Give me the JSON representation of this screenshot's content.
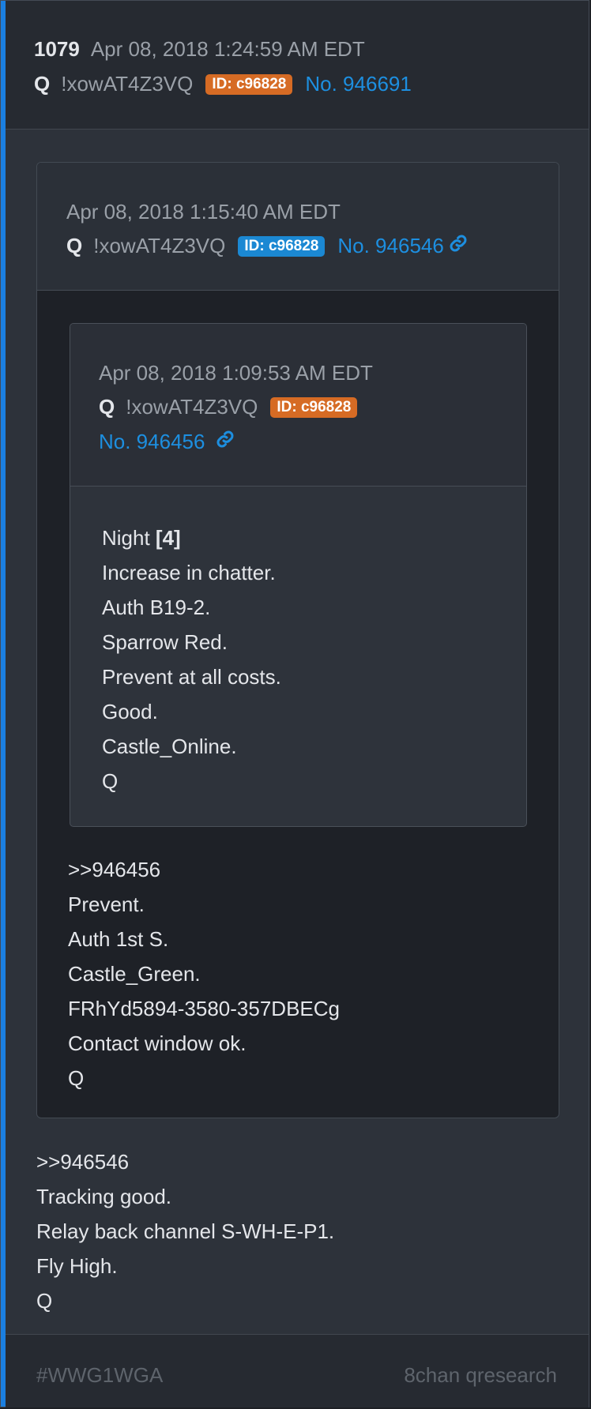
{
  "post": {
    "number": "1079",
    "date": "Apr 08, 2018 1:24:59 AM EDT",
    "author": "Q",
    "tripcode": "!xowAT4Z3VQ",
    "id_badge": "ID: c96828",
    "post_no": "No. 946691",
    "body": [
      ">>946546",
      "Tracking good.",
      "Relay back channel S-WH-E-P1.",
      "Fly High.",
      "Q"
    ]
  },
  "quote1": {
    "date": "Apr 08, 2018 1:15:40 AM EDT",
    "author": "Q",
    "tripcode": "!xowAT4Z3VQ",
    "id_badge": "ID: c96828",
    "post_no": "No. 946546",
    "body": [
      ">>946456",
      "Prevent.",
      "Auth 1st S.",
      "Castle_Green.",
      "FRhYd5894-3580-357DBECg",
      "Contact window ok.",
      "Q"
    ]
  },
  "quote2": {
    "date": "Apr 08, 2018 1:09:53 AM EDT",
    "author": "Q",
    "tripcode": "!xowAT4Z3VQ",
    "id_badge": "ID: c96828",
    "post_no": "No. 946456",
    "body_first_text": "Night ",
    "body_first_bold": "[4]",
    "body": [
      "Increase in chatter.",
      "Auth B19-2.",
      "Sparrow Red.",
      "Prevent at all costs.",
      "Good.",
      "Castle_Online.",
      "Q"
    ]
  },
  "footer": {
    "hashtag": "#WWG1WGA",
    "source": "8chan qresearch"
  },
  "icons": {
    "permalink": "link-icon"
  },
  "colors": {
    "accent": "#1b7fe0",
    "id_orange": "#d66b24",
    "id_blue": "#1b88d3",
    "link": "#1d8fe0"
  }
}
